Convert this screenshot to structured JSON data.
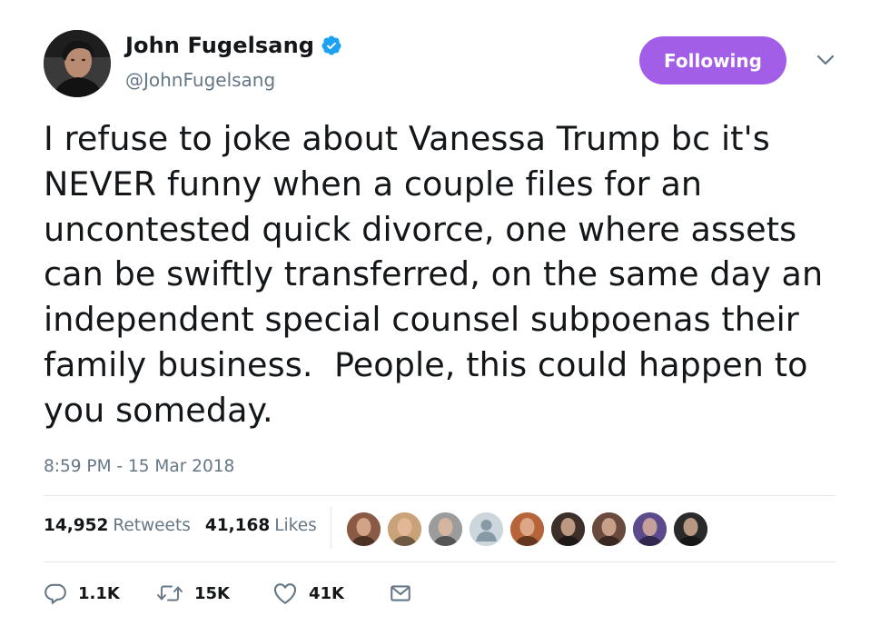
{
  "user": {
    "display_name": "John Fugelsang",
    "handle": "@JohnFugelsang",
    "verified": true,
    "avatar_icon": "avatar-photo"
  },
  "follow_button": {
    "label": "Following",
    "color": "#a25ee7"
  },
  "menu_icon": "chevron-down-icon",
  "tweet": {
    "text": "I refuse to joke about Vanessa Trump bc it's\nNEVER funny when a couple files for an\nuncontested quick divorce, one where assets\ncan be swiftly transferred, on the same day an\nindependent special counsel subpoenas their\nfamily business.  People, this could happen to\nyou someday.",
    "timestamp": "8:59 PM - 15 Mar 2018"
  },
  "stats": {
    "retweets_count": "14,952",
    "retweets_label": "Retweets",
    "likes_count": "41,168",
    "likes_label": "Likes"
  },
  "likers": [
    {
      "name": "liker-avatar-1",
      "color": "#8a5a44"
    },
    {
      "name": "liker-avatar-2",
      "color": "#c9a27a"
    },
    {
      "name": "liker-avatar-3",
      "color": "#9c9c9c"
    },
    {
      "name": "liker-avatar-4",
      "color": "#ccd6dd"
    },
    {
      "name": "liker-avatar-5",
      "color": "#b8643a"
    },
    {
      "name": "liker-avatar-6",
      "color": "#3d2f2a"
    },
    {
      "name": "liker-avatar-7",
      "color": "#6a4a3c"
    },
    {
      "name": "liker-avatar-8",
      "color": "#5b4a8c"
    },
    {
      "name": "liker-avatar-9",
      "color": "#2a2a2a"
    }
  ],
  "actions": {
    "reply": {
      "icon": "reply-icon",
      "count": "1.1K"
    },
    "retweet": {
      "icon": "retweet-icon",
      "count": "15K"
    },
    "like": {
      "icon": "heart-icon",
      "count": "41K"
    },
    "message": {
      "icon": "envelope-icon"
    }
  },
  "colors": {
    "verified_blue": "#1da1f2",
    "secondary_text": "#657786",
    "divider": "#e1e8ed"
  }
}
